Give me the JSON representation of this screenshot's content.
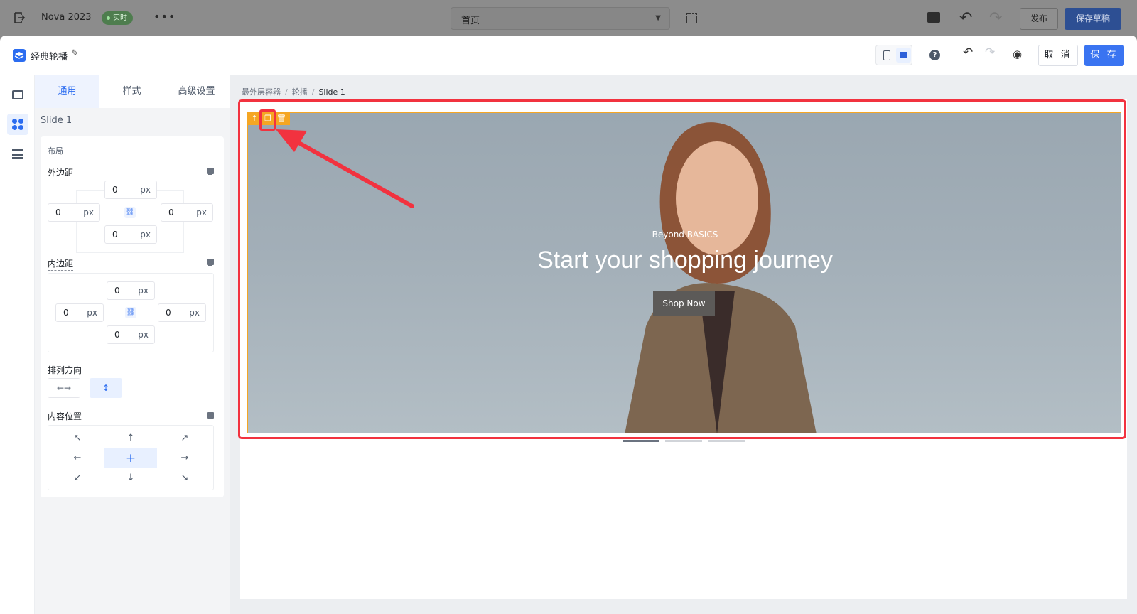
{
  "topbar": {
    "app_name": "Nova 2023",
    "live_badge": "实时",
    "more": "•••",
    "page_select": "首页",
    "publish_label": "发布",
    "save_draft_label": "保存草稿"
  },
  "header": {
    "title": "经典轮播",
    "cancel_label": "取 消",
    "save_label": "保 存"
  },
  "panel": {
    "tabs": [
      "通用",
      "样式",
      "高级设置"
    ],
    "active_tab": "通用",
    "heading": "Slide 1",
    "layout_label": "布局",
    "margin": {
      "label": "外边距",
      "top": "0",
      "left": "0",
      "right": "0",
      "bottom": "0",
      "unit": "px"
    },
    "padding": {
      "label": "内边距",
      "top": "0",
      "left": "0",
      "right": "0",
      "bottom": "0",
      "unit": "px"
    },
    "direction": {
      "label": "排列方向",
      "horizontal": "←→",
      "vertical": "↕"
    },
    "content_position": {
      "label": "内容位置",
      "cells": [
        "↖",
        "↑",
        "↗",
        "←",
        "+",
        "→",
        "↙",
        "↓",
        "↘"
      ],
      "active": "+"
    }
  },
  "canvas": {
    "breadcrumb": [
      "最外层容器",
      "轮播",
      "Slide 1"
    ],
    "hero": {
      "subtitle": "Beyond BASICS",
      "title": "Start your shopping journey",
      "cta": "Shop Now"
    },
    "slide_count": 3,
    "active_slide": 1
  },
  "colors": {
    "primary": "#3a74f1",
    "selection": "#f5a623",
    "annotation": "#f2323f"
  }
}
